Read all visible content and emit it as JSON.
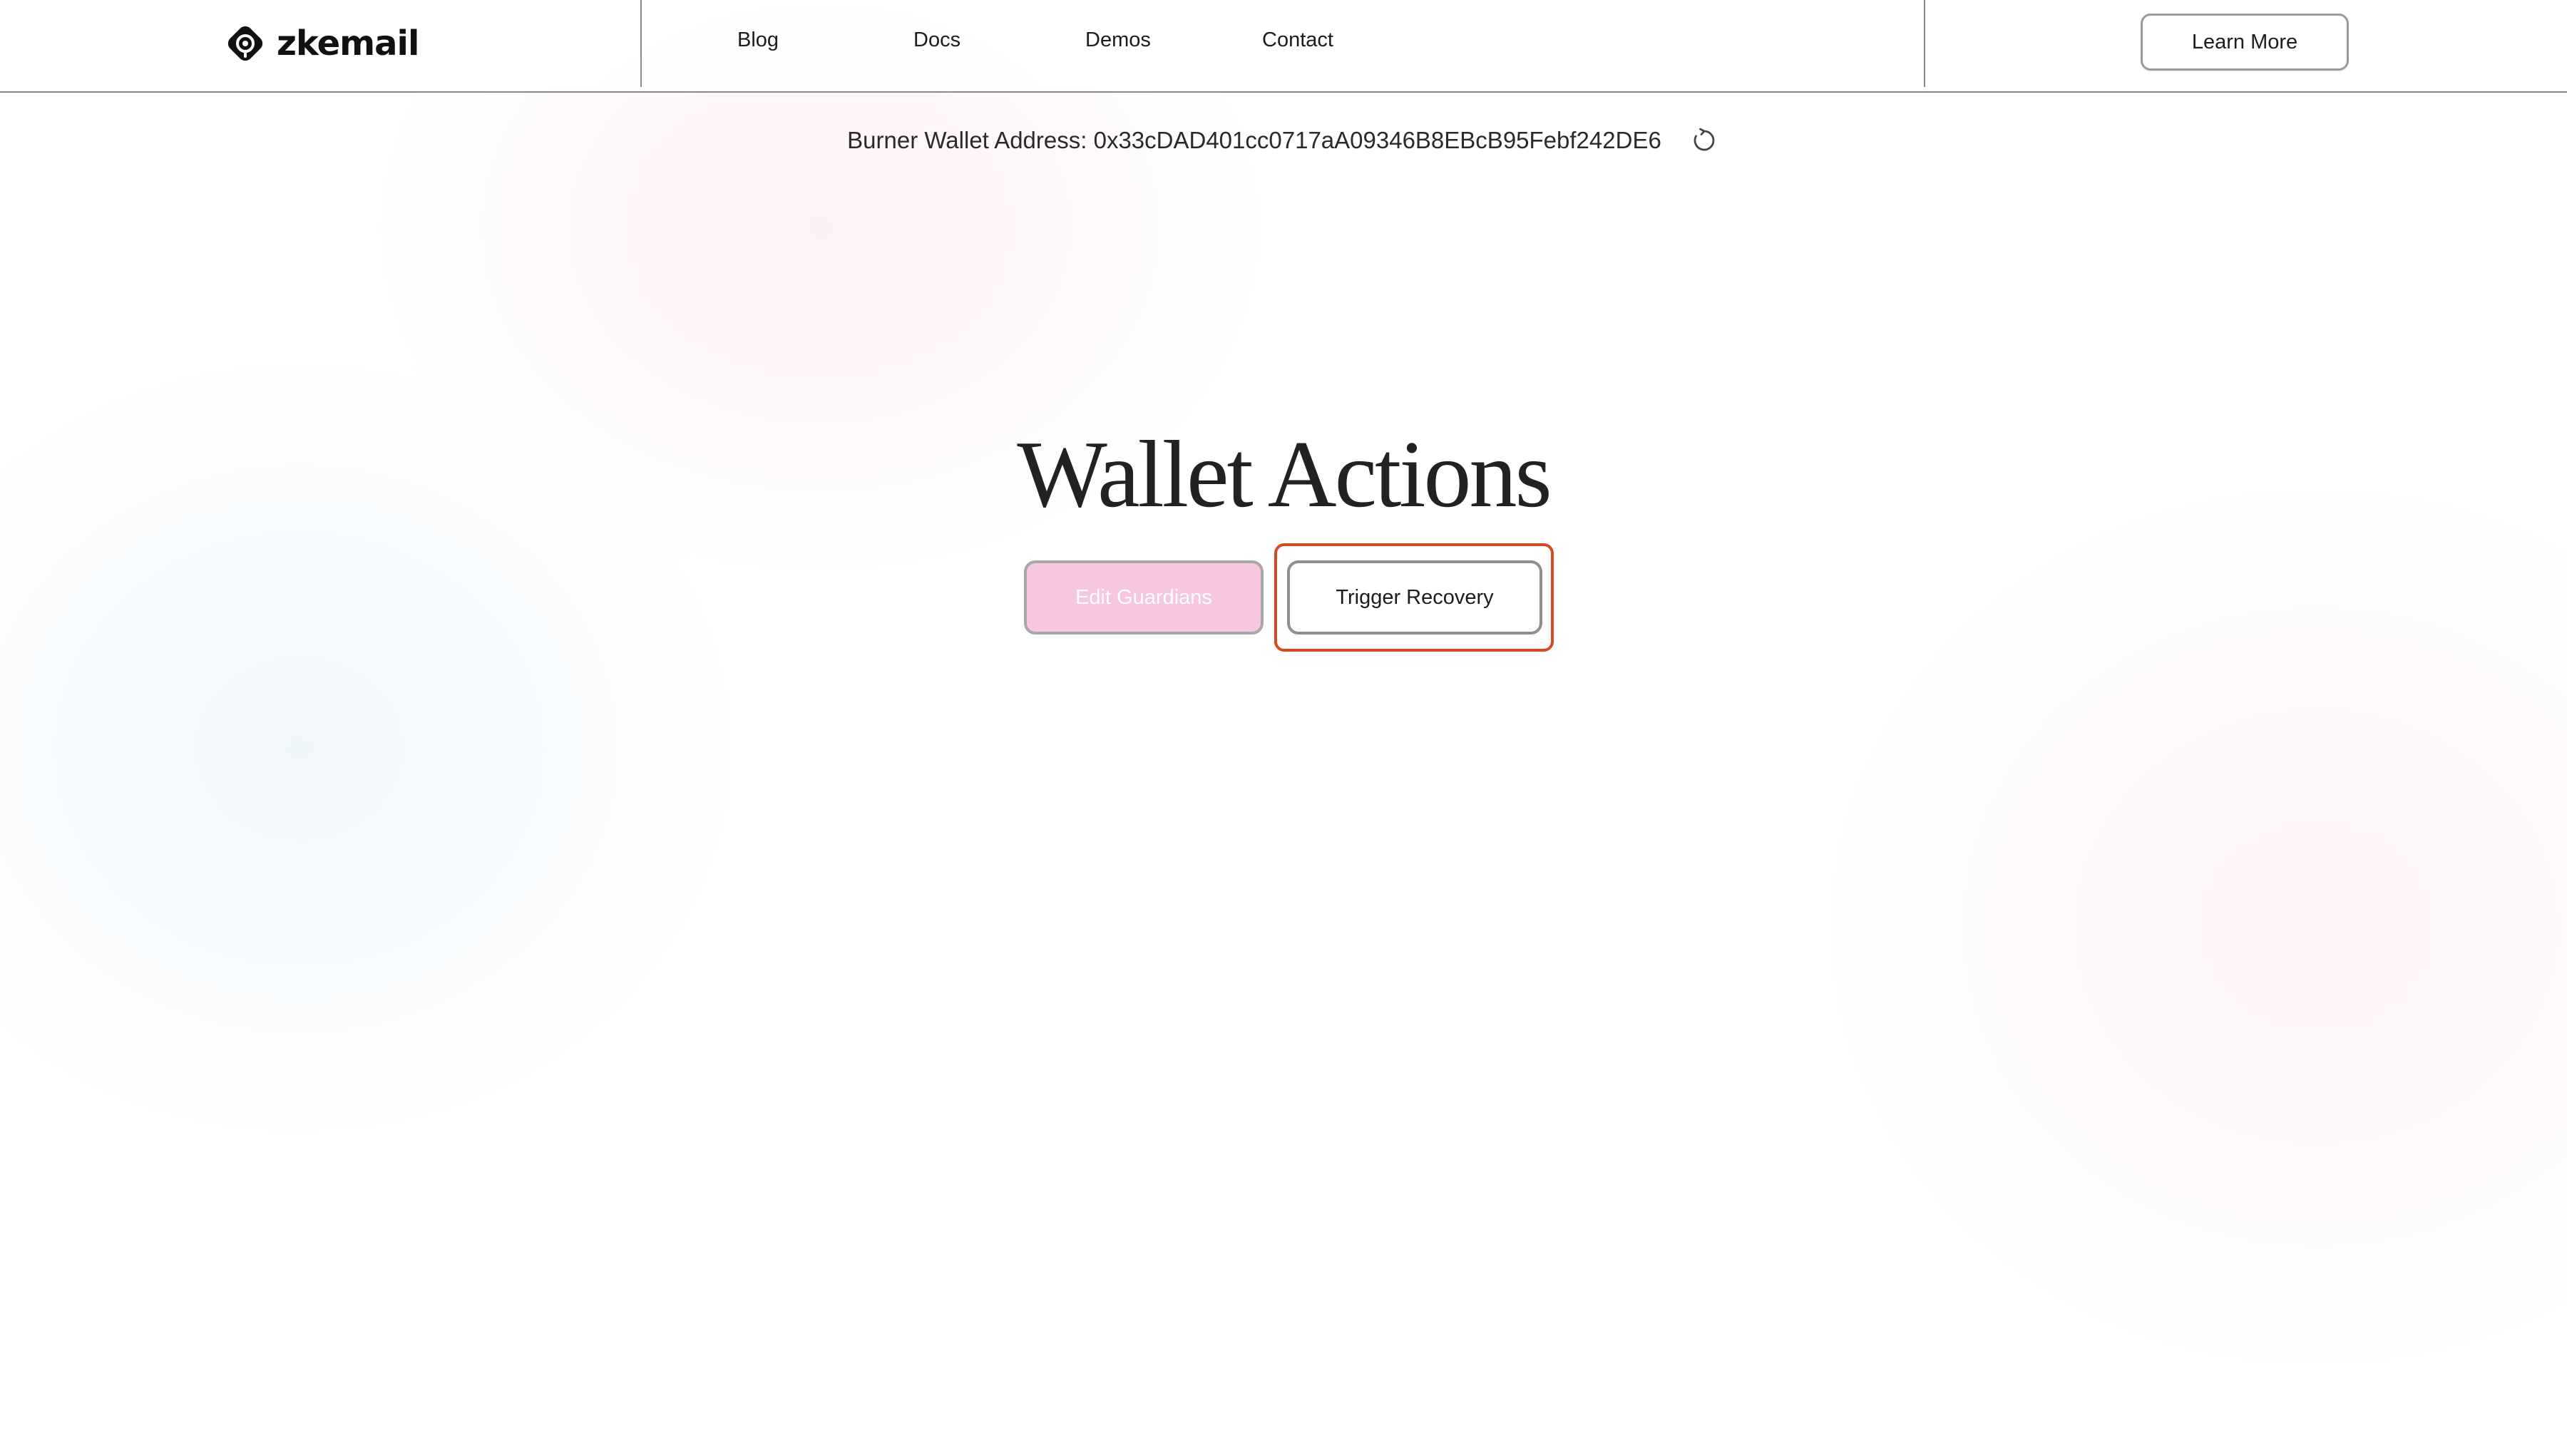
{
  "brand": {
    "name": "zkemail",
    "logo_icon": "zkemail-logo-icon"
  },
  "nav": {
    "links": [
      {
        "label": "Blog"
      },
      {
        "label": "Docs"
      },
      {
        "label": "Demos"
      },
      {
        "label": "Contact"
      }
    ],
    "cta_label": "Learn More"
  },
  "wallet": {
    "address_text": "Burner Wallet Address: 0x33cDAD401cc0717aA09346B8EBcB95Febf242DE6",
    "refresh_icon": "refresh-icon"
  },
  "main": {
    "title": "Wallet Actions",
    "edit_guardians_label": "Edit Guardians",
    "trigger_recovery_label": "Trigger Recovery"
  },
  "colors": {
    "edit_guardians_bg": "#f7c6e0",
    "focus_ring": "#d64a1f"
  }
}
